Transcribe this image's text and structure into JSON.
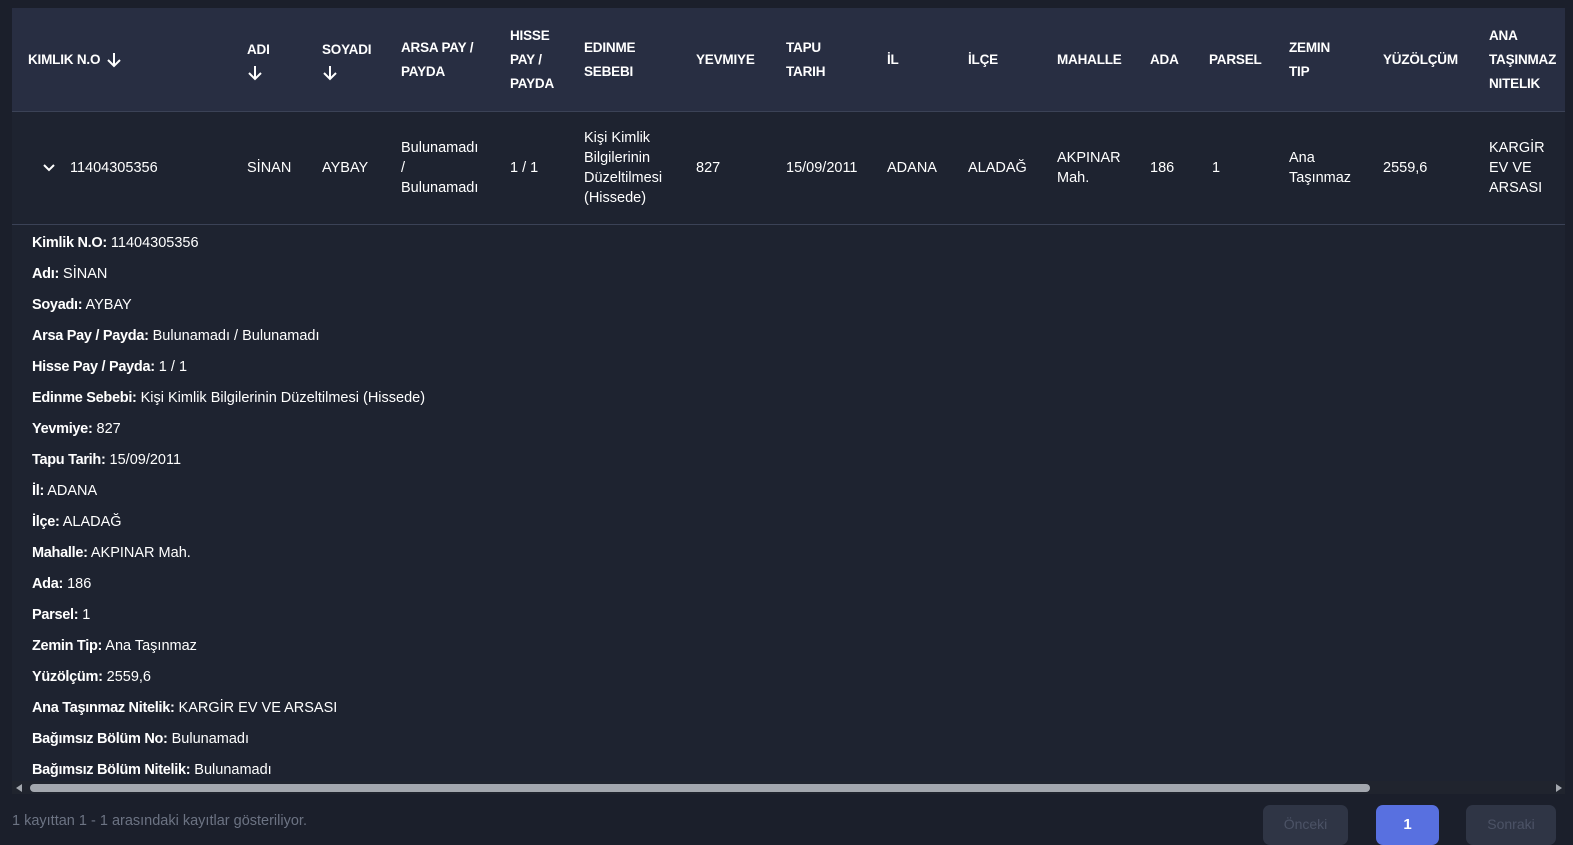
{
  "table": {
    "headers": {
      "kimlik": "KIMLIK N.O",
      "adi": "ADI",
      "soyadi": "SOYADI",
      "arsa_l1": "ARSA PAY /",
      "arsa_l2": "PAYDA",
      "hisse_l1": "HISSE",
      "hisse_l2": "PAY /",
      "hisse_l3": "PAYDA",
      "edinme_l1": "EDINME",
      "edinme_l2": "SEBEBI",
      "yevmiye": "YEVMIYE",
      "tapu_l1": "TAPU",
      "tapu_l2": "TARIH",
      "il": "İL",
      "ilce": "İLÇE",
      "mahalle": "MAHALLE",
      "ada": "ADA",
      "parsel": "PARSEL",
      "zemin_l1": "ZEMIN",
      "zemin_l2": "TIP",
      "yuzolcum": "YÜZÖLÇÜM",
      "ana_l1": "ANA",
      "ana_l2": "TAŞINMAZ",
      "ana_l3": "NITELIK"
    },
    "row": {
      "kimlik": "11404305356",
      "adi": "SİNAN",
      "soyadi": "AYBAY",
      "arsa_l1": "Bulunamadı",
      "arsa_l2": "/",
      "arsa_l3": "Bulunamadı",
      "hisse": "1 / 1",
      "edinme_l1": "Kişi Kimlik",
      "edinme_l2": "Bilgilerinin",
      "edinme_l3": "Düzeltilmesi",
      "edinme_l4": "(Hissede)",
      "yevmiye": "827",
      "tapu": "15/09/2011",
      "il": "ADANA",
      "ilce": "ALADAĞ",
      "mahalle_l1": "AKPINAR",
      "mahalle_l2": "Mah.",
      "ada": "186",
      "parsel": "1",
      "zemin_l1": "Ana",
      "zemin_l2": "Taşınmaz",
      "yuzolcum": "2559,6",
      "ana_l1": "KARGİR",
      "ana_l2": "EV VE",
      "ana_l3": "ARSASI"
    }
  },
  "details": [
    {
      "label": "Kimlik N.O:",
      "value": "11404305356"
    },
    {
      "label": "Adı:",
      "value": "SİNAN"
    },
    {
      "label": "Soyadı:",
      "value": "AYBAY"
    },
    {
      "label": "Arsa Pay / Payda:",
      "value": "Bulunamadı / Bulunamadı"
    },
    {
      "label": "Hisse Pay / Payda:",
      "value": "1 / 1"
    },
    {
      "label": "Edinme Sebebi:",
      "value": "Kişi Kimlik Bilgilerinin Düzeltilmesi (Hissede)"
    },
    {
      "label": "Yevmiye:",
      "value": "827"
    },
    {
      "label": "Tapu Tarih:",
      "value": "15/09/2011"
    },
    {
      "label": "İl:",
      "value": "ADANA"
    },
    {
      "label": "İlçe:",
      "value": "ALADAĞ"
    },
    {
      "label": "Mahalle:",
      "value": "AKPINAR Mah."
    },
    {
      "label": "Ada:",
      "value": "186"
    },
    {
      "label": "Parsel:",
      "value": "1"
    },
    {
      "label": "Zemin Tip:",
      "value": "Ana Taşınmaz"
    },
    {
      "label": "Yüzölçüm:",
      "value": "2559,6"
    },
    {
      "label": "Ana Taşınmaz Nitelik:",
      "value": "KARGİR EV VE ARSASI"
    },
    {
      "label": "Bağımsız Bölüm No:",
      "value": "Bulunamadı"
    },
    {
      "label": "Bağımsız Bölüm Nitelik:",
      "value": "Bulunamadı"
    }
  ],
  "footer": {
    "info": "1 kayıttan 1 - 1 arasındaki kayıtlar gösteriliyor.",
    "prev": "Önceki",
    "current": "1",
    "next": "Sonraki"
  },
  "icons": {
    "sort": "arrow-down-icon",
    "expand": "chevron-down-icon"
  },
  "colors": {
    "background": "#1e2330",
    "header": "#282e42",
    "accent": "#5870e0"
  }
}
